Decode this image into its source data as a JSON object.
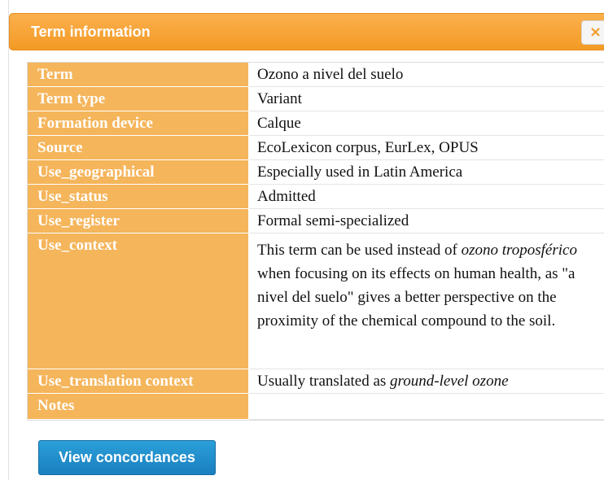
{
  "dialog": {
    "title": "Term information",
    "close_label": "×"
  },
  "rows": [
    {
      "label": "Term",
      "value": "Ozono a nivel del suelo"
    },
    {
      "label": "Term type",
      "value": "Variant"
    },
    {
      "label": "Formation device",
      "value": "Calque"
    },
    {
      "label": "Source",
      "value": "EcoLexicon corpus, EurLex, OPUS"
    },
    {
      "label": "Use_geographical",
      "value": "Especially used in Latin America"
    },
    {
      "label": "Use_status",
      "value": "Admitted"
    },
    {
      "label": "Use_register",
      "value": "Formal semi-specialized"
    },
    {
      "label": "Use_context",
      "value_before": "This term can be used instead of ",
      "value_italic": "ozono troposférico",
      "value_after": " when focusing on its effects on human health, as \"a nivel del suelo\" gives a better perspective on the proximity of the chemical compound to the soil."
    },
    {
      "label": "Use_translation context",
      "value_before": "Usually translated as ",
      "value_italic": "ground-level ozone"
    },
    {
      "label": "Notes",
      "value": ""
    }
  ],
  "actions": {
    "view_concordances": "View concordances"
  },
  "colors": {
    "header_orange": "#f39a25",
    "label_orange": "#f5b55b",
    "button_blue": "#1a7fc0"
  }
}
